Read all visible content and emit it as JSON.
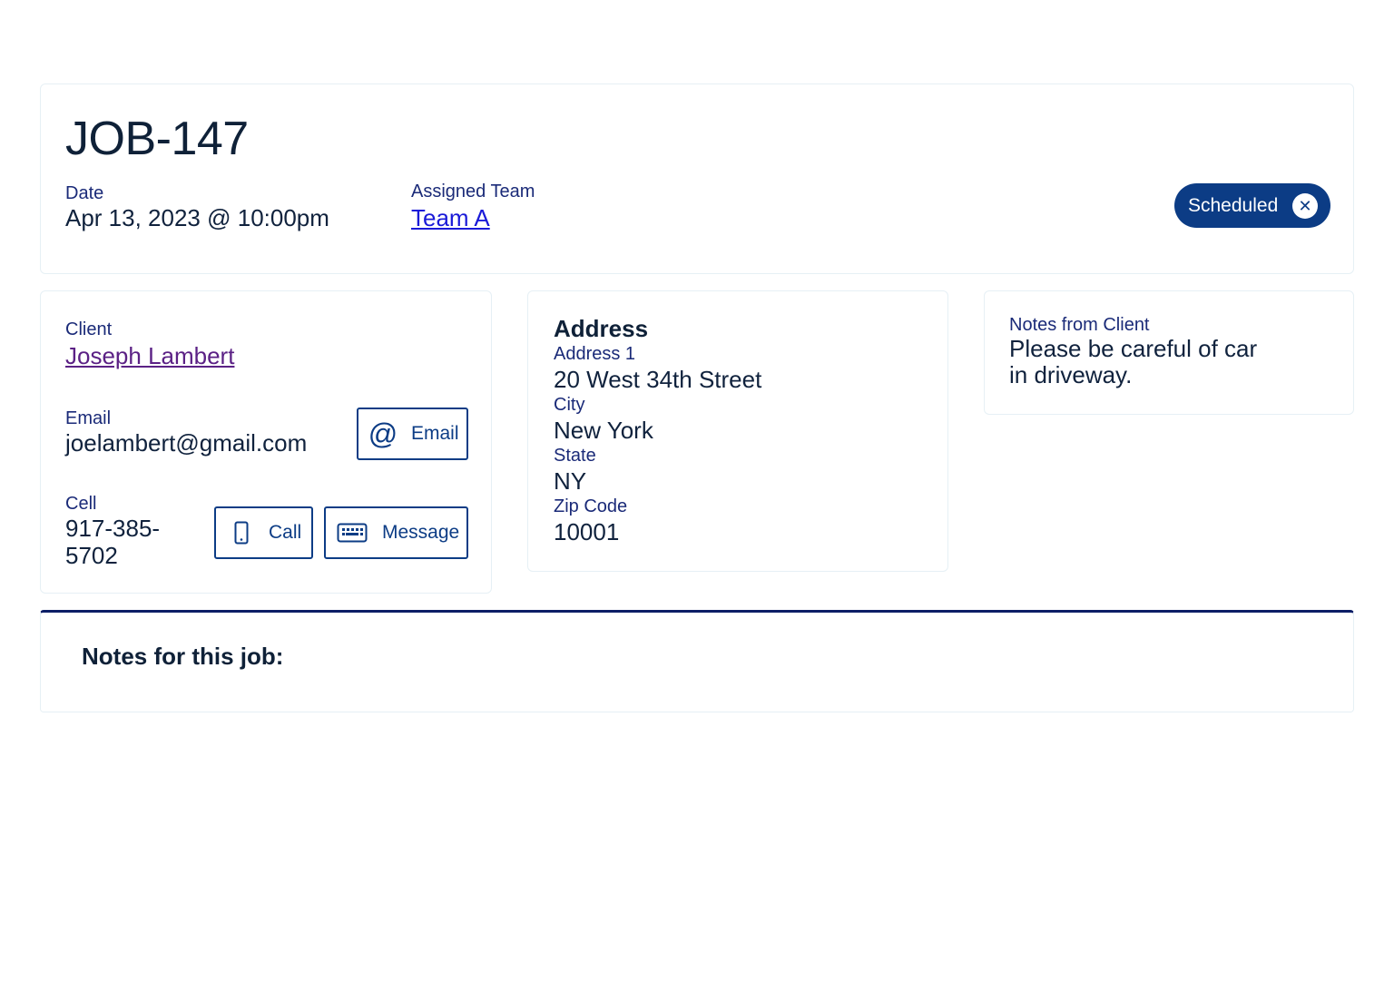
{
  "job": {
    "title": "JOB-147",
    "date_label": "Date",
    "date_value": "Apr 13, 2023 @ 10:00pm",
    "team_label": "Assigned Team",
    "team_value": "Team A",
    "status": "Scheduled",
    "status_icon": "close-circle-icon"
  },
  "client": {
    "label": "Client",
    "name": "Joseph Lambert",
    "email_label": "Email",
    "email_value": "joelambert@gmail.com",
    "email_button": "Email",
    "cell_label": "Cell",
    "cell_value_line1": "917-385-",
    "cell_value_line2": "5702",
    "call_button": "Call",
    "message_button": "Message"
  },
  "address": {
    "heading": "Address",
    "address1_label": "Address 1",
    "address1_value": "20 West 34th Street",
    "city_label": "City",
    "city_value": "New York",
    "state_label": "State",
    "state_value": "NY",
    "zip_label": "Zip Code",
    "zip_value": "10001"
  },
  "client_notes": {
    "label": "Notes from Client",
    "value": "Please be careful of car in driveway."
  },
  "job_notes": {
    "title": "Notes for this job:"
  },
  "colors": {
    "primary": "#0c3c85",
    "label": "#1a2a78",
    "link_team": "#1a1ad8",
    "link_client": "#5b2185"
  }
}
